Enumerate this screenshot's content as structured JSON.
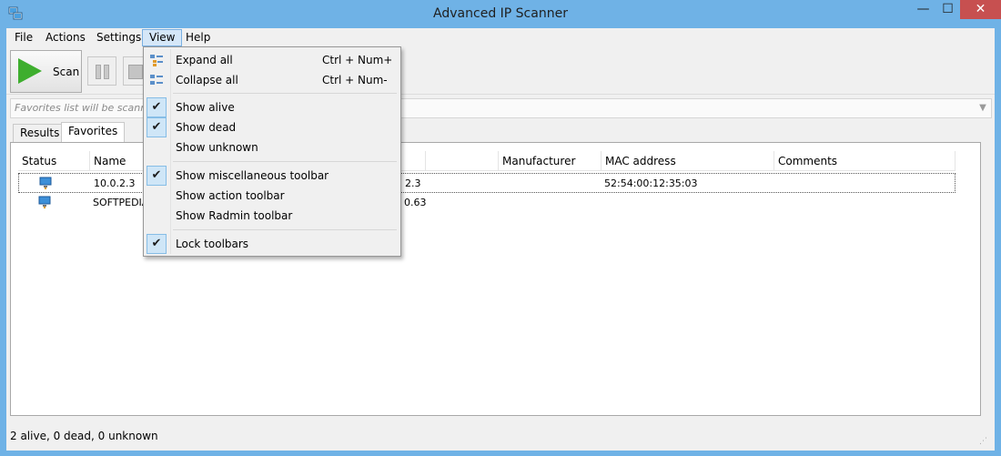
{
  "window": {
    "title": "Advanced IP Scanner",
    "minimize": "—",
    "maximize": "☐",
    "close": "✕"
  },
  "menubar": [
    "File",
    "Actions",
    "Settings",
    "View",
    "Help"
  ],
  "toolbar": {
    "scan_label": "Scan"
  },
  "addressbar": {
    "placeholder": "Favorites list will be scanned"
  },
  "tabs": [
    "Results",
    "Favorites"
  ],
  "columns": [
    "Status",
    "Name",
    "",
    "Manufacturer",
    "MAC address",
    "Comments"
  ],
  "rows": [
    {
      "name": "10.0.2.3",
      "ip": "2.3",
      "mac": "52:54:00:12:35:03",
      "selected": true
    },
    {
      "name": "SOFTPEDIA",
      "ip": "0.63",
      "mac": ""
    }
  ],
  "status": "2 alive, 0 dead, 0 unknown",
  "view_menu": {
    "items": [
      {
        "label": "Expand all",
        "shortcut": "Ctrl + Num+",
        "icon": "expand-all-icon"
      },
      {
        "label": "Collapse all",
        "shortcut": "Ctrl + Num-",
        "icon": "collapse-all-icon"
      },
      {
        "label": "Show alive",
        "checked": true
      },
      {
        "label": "Show dead",
        "checked": true
      },
      {
        "label": "Show unknown",
        "checked": false
      },
      {
        "label": "Show miscellaneous toolbar",
        "checked": true
      },
      {
        "label": "Show action toolbar",
        "checked": false
      },
      {
        "label": "Show Radmin toolbar",
        "checked": false
      },
      {
        "label": "Lock toolbars",
        "checked": true
      }
    ],
    "check_glyph": "✔"
  },
  "colors": {
    "titlebar": "#6fb2e6",
    "close": "#c75050",
    "accent": "#cfe6f7"
  }
}
